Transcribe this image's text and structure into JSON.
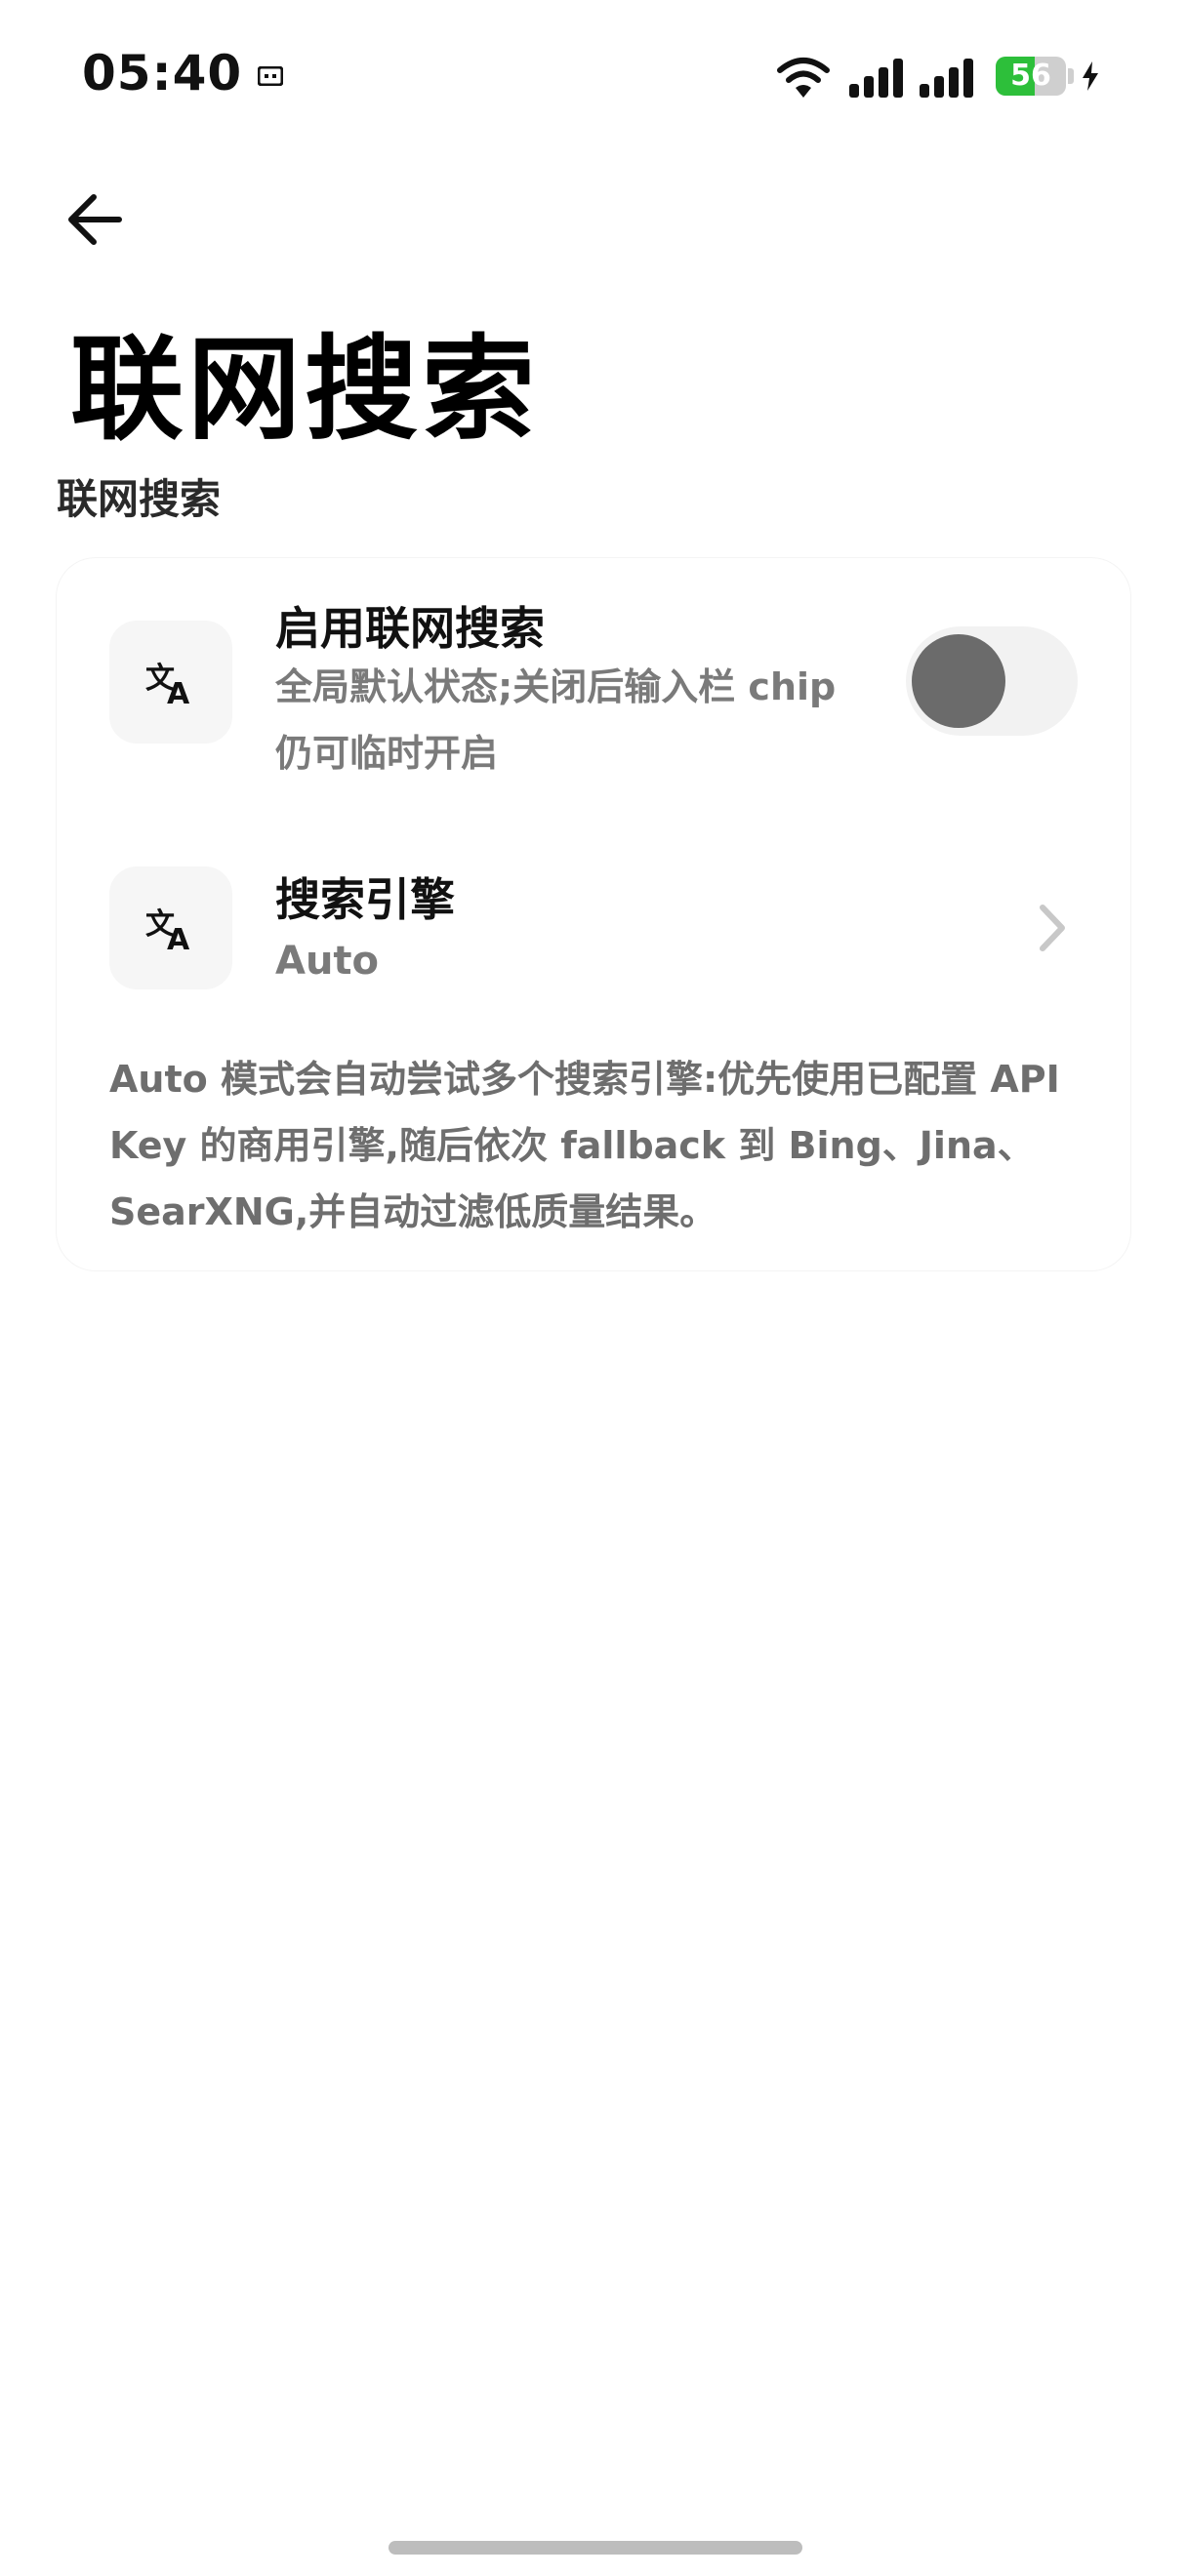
{
  "status_bar": {
    "time": "05:40",
    "battery_level": "56",
    "icons": [
      "notification-icon",
      "wifi-icon",
      "signal-icon",
      "signal-icon",
      "battery-icon",
      "charging-icon"
    ]
  },
  "header": {
    "back_icon": "arrow-left-icon",
    "title": "联网搜索"
  },
  "section": {
    "title": "联网搜索"
  },
  "settings": {
    "web_search": {
      "icon": "translate-icon",
      "title": "启用联网搜索",
      "subtitle": "全局默认状态;关闭后输入栏 chip 仍可临时开启",
      "enabled": false
    },
    "search_engine": {
      "icon": "translate-icon",
      "title": "搜索引擎",
      "value": "Auto"
    },
    "note": "Auto 模式会自动尝试多个搜索引擎:优先使用已配置 API Key 的商用引擎,随后依次 fallback 到 Bing、Jina、SearXNG,并自动过滤低质量结果。"
  },
  "colors": {
    "toggle_knob": "#6b6b6b",
    "toggle_track": "#f2f2f2",
    "battery_fill": "#2dbf3a",
    "secondary_text": "#7a7a7a"
  }
}
